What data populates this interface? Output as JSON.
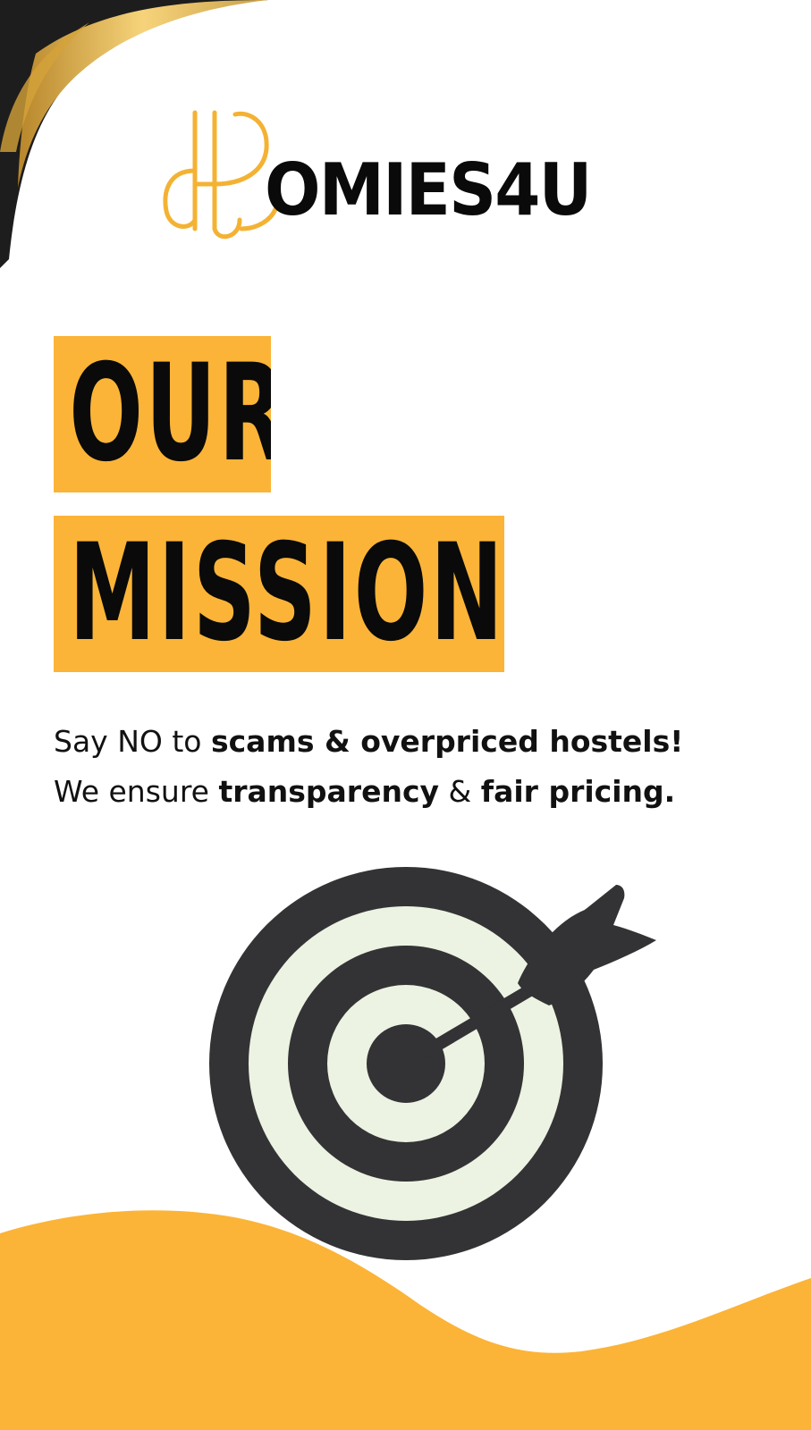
{
  "brand": {
    "monogram_letter": "H",
    "wordmark": "OMIES4U",
    "gold_color": "#f4b233",
    "text_color": "#0a0a0a"
  },
  "headline": {
    "line1": "OUR",
    "line2": "MISSION",
    "highlight_color": "#fbb437"
  },
  "tagline": {
    "line1_plain": "Say NO to ",
    "line1_bold": "scams & overpriced hostels!",
    "line2_plain1": "We ensure ",
    "line2_bold1": "transparency",
    "line2_plain2": " & ",
    "line2_bold2": "fair pricing."
  },
  "illustration": {
    "icon": "target-with-arrow-icon",
    "dark_color": "#333336",
    "light_color": "#edf3e2"
  },
  "decor": {
    "corner_icon": "gold-black-swoosh",
    "wave_color": "#fbb437"
  }
}
